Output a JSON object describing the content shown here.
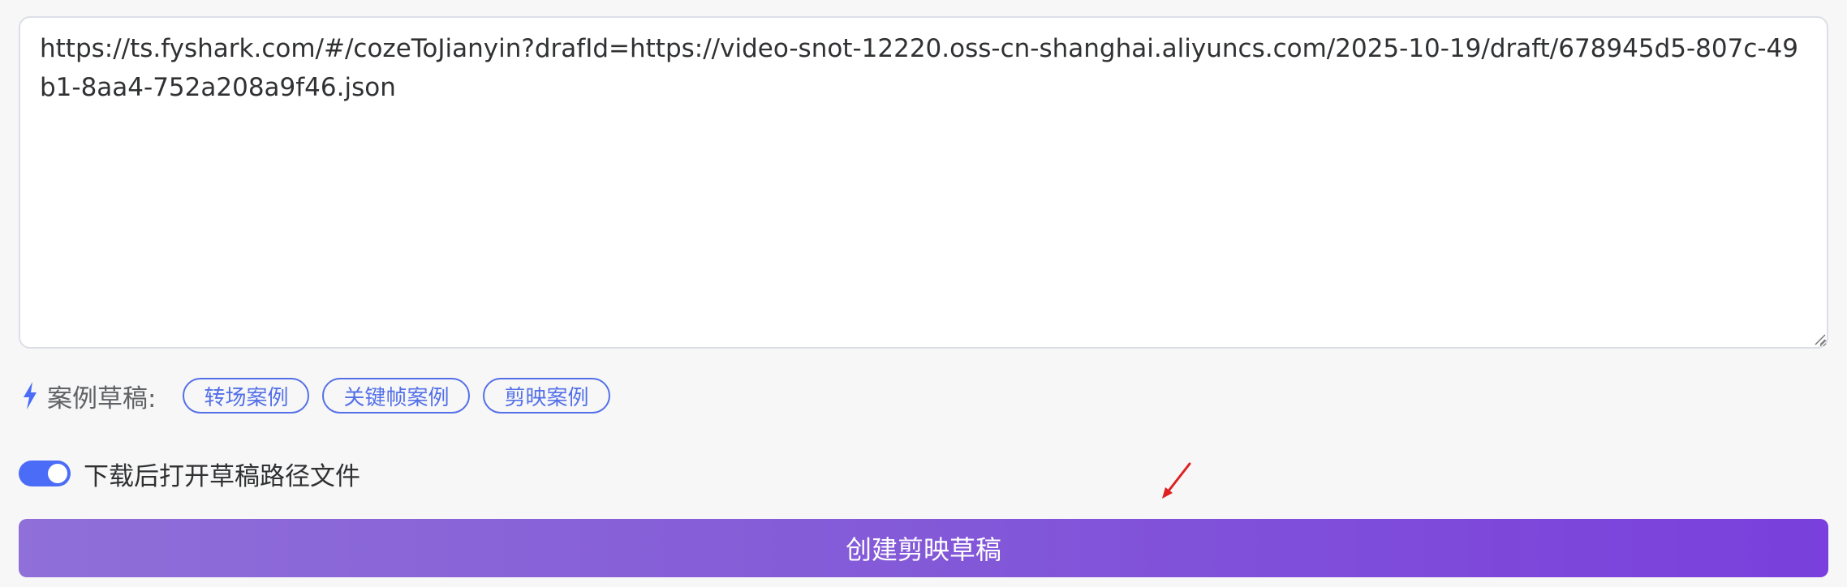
{
  "draft_input": {
    "value": "https://ts.fyshark.com/#/cozeToJianyin?drafId=https://video-snot-12220.oss-cn-shanghai.aliyuncs.com/2025-10-19/draft/678945d5-807c-49b1-8aa4-752a208a9f46.json"
  },
  "examples": {
    "icon": "bolt-icon",
    "label": "案例草稿:",
    "tags": [
      "转场案例",
      "关键帧案例",
      "剪映案例"
    ]
  },
  "open_after_download": {
    "enabled": true,
    "label": "下载后打开草稿路径文件"
  },
  "create_button": {
    "label": "创建剪映草稿"
  },
  "colors": {
    "accent": "#4a6cf7",
    "tag_border": "#5470e8",
    "button_gradient_start": "#8f6fd8",
    "button_gradient_end": "#7a3fdc",
    "annotation_arrow": "#e02020"
  }
}
